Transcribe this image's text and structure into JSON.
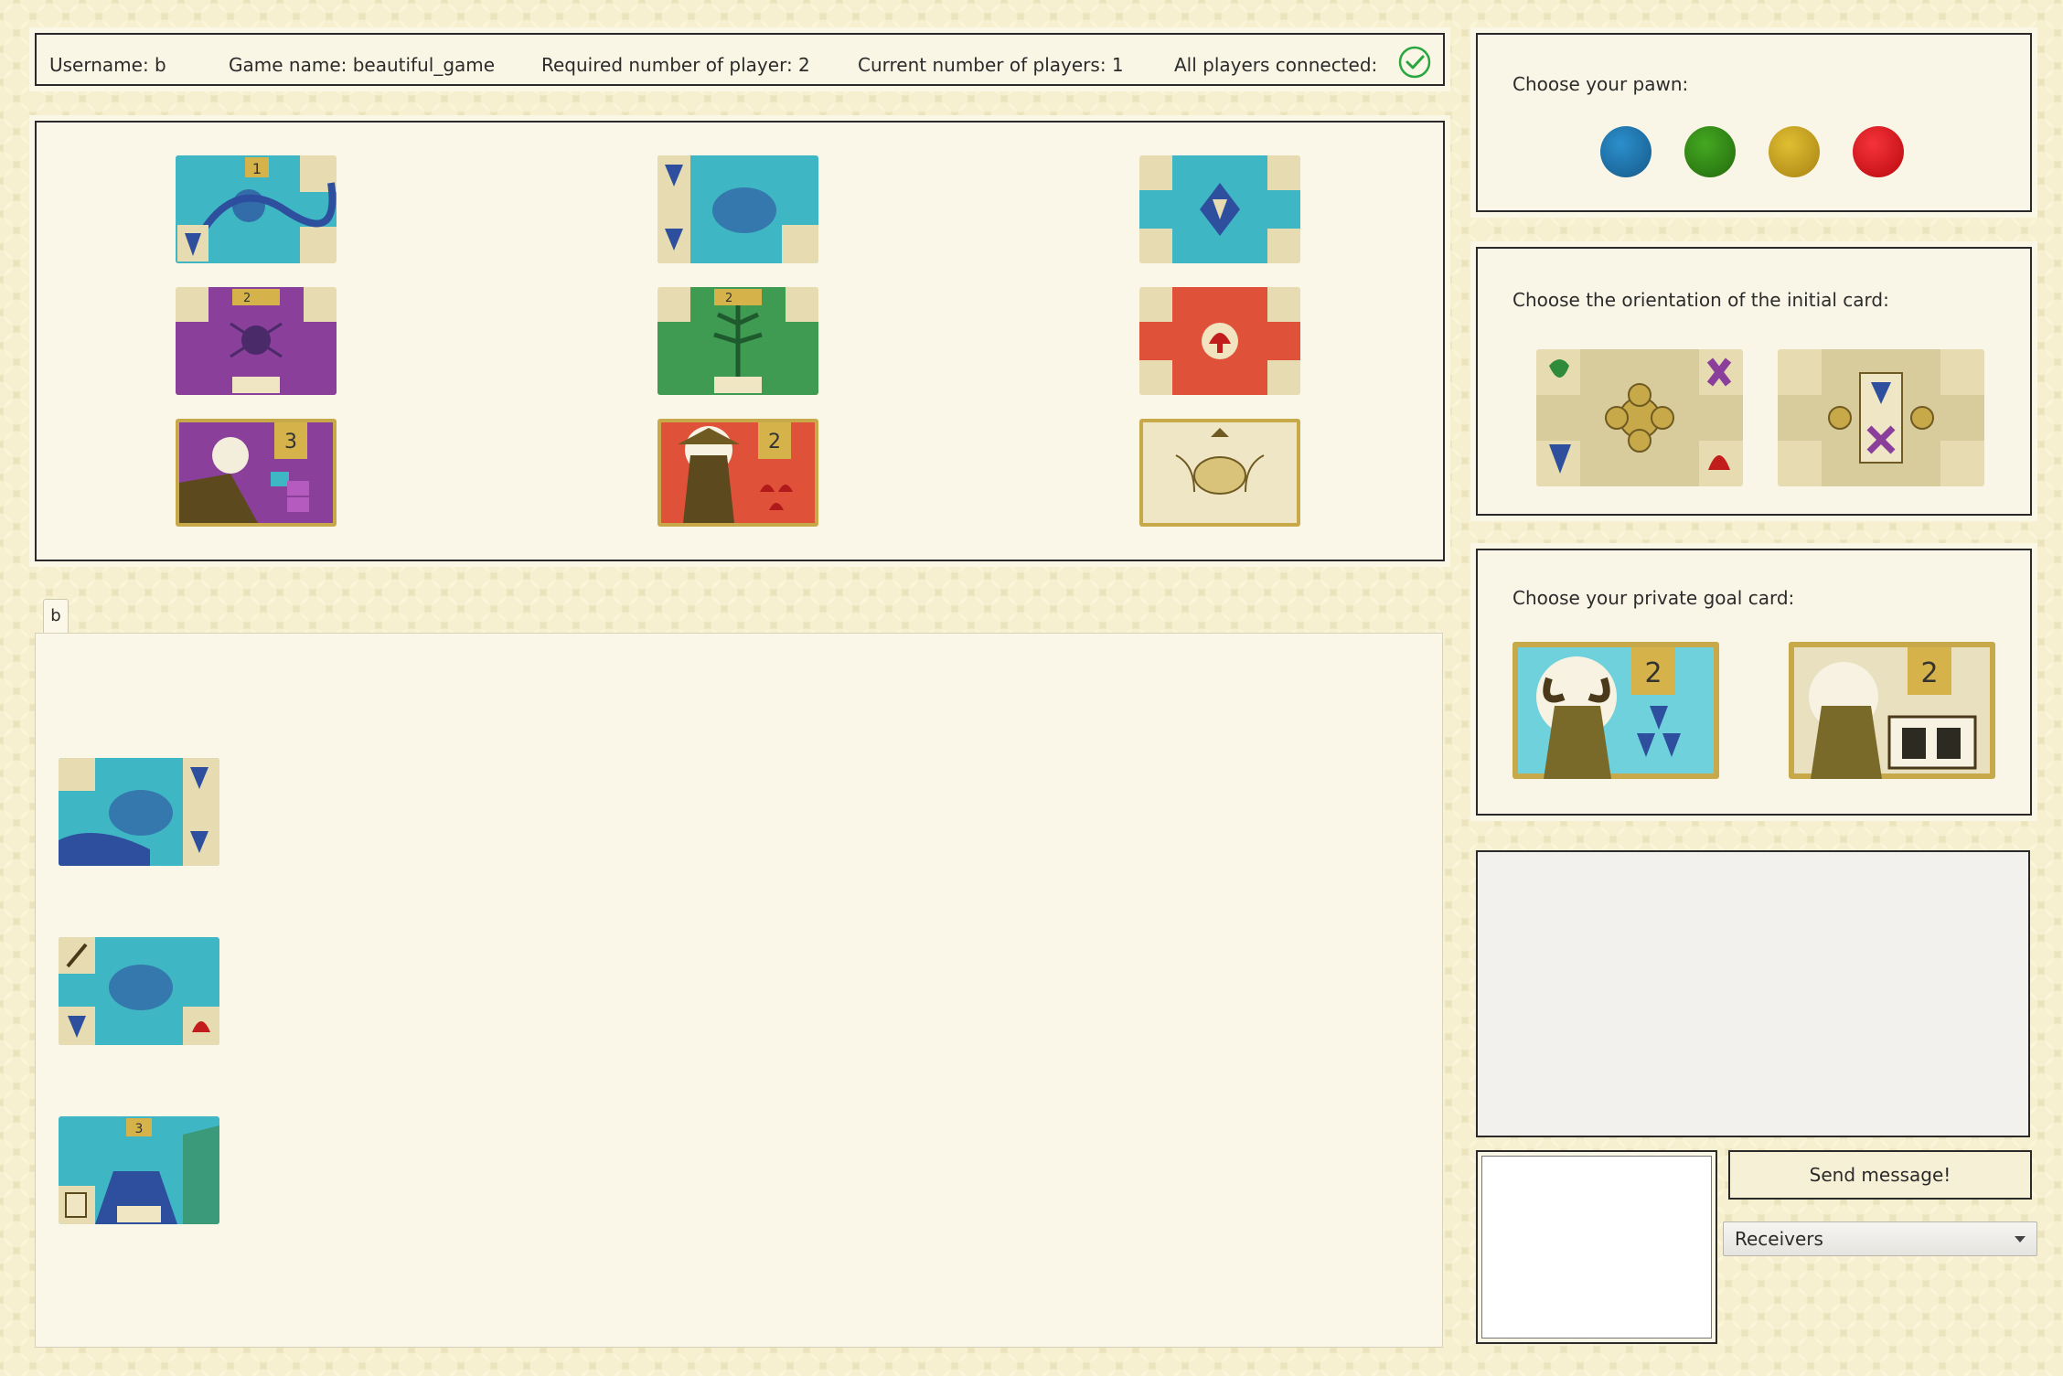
{
  "status": {
    "username": "Username: b",
    "game_name": "Game name: beautiful_game",
    "required_players": "Required number of player: 2",
    "current_players": "Current number of players: 1",
    "all_connected": "All players connected:",
    "connected_icon": "check-circle-icon"
  },
  "market": {
    "cards": [
      {
        "name": "bird-resource-card-1",
        "color": "#3fb6c4",
        "icon": "bird",
        "badge": "1"
      },
      {
        "name": "frog-resource-card",
        "color": "#3fb6c4",
        "icon": "frog"
      },
      {
        "name": "blue-cross-card",
        "color": "#3fb6c4",
        "icon": "wolf"
      },
      {
        "name": "spider-resource-card-2",
        "color": "#8a3f9a",
        "icon": "spider",
        "badge": "2"
      },
      {
        "name": "plant-resource-card-2",
        "color": "#3f9a52",
        "icon": "plant",
        "badge": "2"
      },
      {
        "name": "red-cross-card",
        "color": "#e0513a",
        "icon": "mushroom"
      },
      {
        "name": "gold-card-3-purple",
        "color": "#8a3f9a",
        "icon": "gold",
        "badge": "3"
      },
      {
        "name": "gold-card-2-red",
        "color": "#e0513a",
        "icon": "gold",
        "badge": "2"
      },
      {
        "name": "starter-card-back",
        "color": "#e8dcae",
        "icon": "starter"
      }
    ]
  },
  "board": {
    "tab_label": "b",
    "hand": [
      {
        "name": "hand-card-frog",
        "color": "#3fb6c4"
      },
      {
        "name": "hand-card-feather",
        "color": "#3fb6c4"
      },
      {
        "name": "hand-card-deer",
        "color": "#3fb6c4",
        "badge": "3"
      }
    ]
  },
  "pawn_panel": {
    "label": "Choose your pawn:",
    "pawns": [
      {
        "name": "blue-pawn",
        "color": "#1b6fa8"
      },
      {
        "name": "green-pawn",
        "color": "#2f8a16"
      },
      {
        "name": "yellow-pawn",
        "color": "#c9a21a"
      },
      {
        "name": "red-pawn",
        "color": "#e0181e"
      }
    ]
  },
  "orientation_panel": {
    "label": "Choose the orientation of the initial card:",
    "options": [
      {
        "name": "initial-card-front"
      },
      {
        "name": "initial-card-back"
      }
    ]
  },
  "goal_panel": {
    "label": "Choose your private goal card:",
    "cards": [
      {
        "name": "goal-card-wolves",
        "badge": "2",
        "color": "#6fd1dc"
      },
      {
        "name": "goal-card-inkwells",
        "badge": "2",
        "color": "#e9e0bf"
      }
    ]
  },
  "chat": {
    "send_label": "Send message!",
    "receivers_label": "Receivers"
  }
}
